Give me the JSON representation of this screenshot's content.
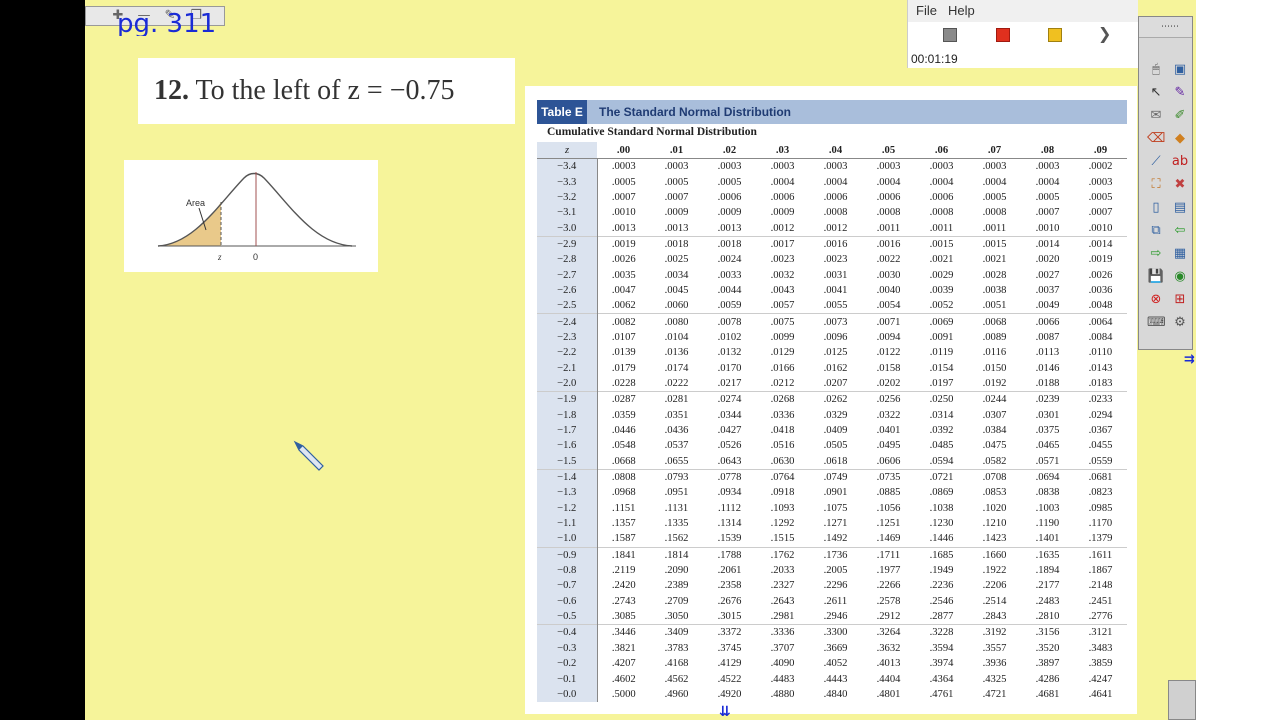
{
  "page_label": "pg. 311",
  "problem": {
    "number": "12.",
    "text": "To the left of z = −0.75"
  },
  "curve_figure": {
    "area_label": "Area",
    "z_label": "z",
    "zero_label": "0",
    "shade_color": "#e9c98a"
  },
  "table": {
    "tag": "Table E",
    "title": "The Standard Normal Distribution",
    "subtitle": "Cumulative Standard Normal Distribution",
    "z_header": "z",
    "columns": [
      ".00",
      ".01",
      ".02",
      ".03",
      ".04",
      ".05",
      ".06",
      ".07",
      ".08",
      ".09"
    ],
    "rows": [
      {
        "z": "−3.4",
        "v": [
          ".0003",
          ".0003",
          ".0003",
          ".0003",
          ".0003",
          ".0003",
          ".0003",
          ".0003",
          ".0003",
          ".0002"
        ]
      },
      {
        "z": "−3.3",
        "v": [
          ".0005",
          ".0005",
          ".0005",
          ".0004",
          ".0004",
          ".0004",
          ".0004",
          ".0004",
          ".0004",
          ".0003"
        ]
      },
      {
        "z": "−3.2",
        "v": [
          ".0007",
          ".0007",
          ".0006",
          ".0006",
          ".0006",
          ".0006",
          ".0006",
          ".0005",
          ".0005",
          ".0005"
        ]
      },
      {
        "z": "−3.1",
        "v": [
          ".0010",
          ".0009",
          ".0009",
          ".0009",
          ".0008",
          ".0008",
          ".0008",
          ".0008",
          ".0007",
          ".0007"
        ]
      },
      {
        "z": "−3.0",
        "v": [
          ".0013",
          ".0013",
          ".0013",
          ".0012",
          ".0012",
          ".0011",
          ".0011",
          ".0011",
          ".0010",
          ".0010"
        ]
      },
      {
        "z": "−2.9",
        "v": [
          ".0019",
          ".0018",
          ".0018",
          ".0017",
          ".0016",
          ".0016",
          ".0015",
          ".0015",
          ".0014",
          ".0014"
        ]
      },
      {
        "z": "−2.8",
        "v": [
          ".0026",
          ".0025",
          ".0024",
          ".0023",
          ".0023",
          ".0022",
          ".0021",
          ".0021",
          ".0020",
          ".0019"
        ]
      },
      {
        "z": "−2.7",
        "v": [
          ".0035",
          ".0034",
          ".0033",
          ".0032",
          ".0031",
          ".0030",
          ".0029",
          ".0028",
          ".0027",
          ".0026"
        ]
      },
      {
        "z": "−2.6",
        "v": [
          ".0047",
          ".0045",
          ".0044",
          ".0043",
          ".0041",
          ".0040",
          ".0039",
          ".0038",
          ".0037",
          ".0036"
        ]
      },
      {
        "z": "−2.5",
        "v": [
          ".0062",
          ".0060",
          ".0059",
          ".0057",
          ".0055",
          ".0054",
          ".0052",
          ".0051",
          ".0049",
          ".0048"
        ]
      },
      {
        "z": "−2.4",
        "v": [
          ".0082",
          ".0080",
          ".0078",
          ".0075",
          ".0073",
          ".0071",
          ".0069",
          ".0068",
          ".0066",
          ".0064"
        ]
      },
      {
        "z": "−2.3",
        "v": [
          ".0107",
          ".0104",
          ".0102",
          ".0099",
          ".0096",
          ".0094",
          ".0091",
          ".0089",
          ".0087",
          ".0084"
        ]
      },
      {
        "z": "−2.2",
        "v": [
          ".0139",
          ".0136",
          ".0132",
          ".0129",
          ".0125",
          ".0122",
          ".0119",
          ".0116",
          ".0113",
          ".0110"
        ]
      },
      {
        "z": "−2.1",
        "v": [
          ".0179",
          ".0174",
          ".0170",
          ".0166",
          ".0162",
          ".0158",
          ".0154",
          ".0150",
          ".0146",
          ".0143"
        ]
      },
      {
        "z": "−2.0",
        "v": [
          ".0228",
          ".0222",
          ".0217",
          ".0212",
          ".0207",
          ".0202",
          ".0197",
          ".0192",
          ".0188",
          ".0183"
        ]
      },
      {
        "z": "−1.9",
        "v": [
          ".0287",
          ".0281",
          ".0274",
          ".0268",
          ".0262",
          ".0256",
          ".0250",
          ".0244",
          ".0239",
          ".0233"
        ]
      },
      {
        "z": "−1.8",
        "v": [
          ".0359",
          ".0351",
          ".0344",
          ".0336",
          ".0329",
          ".0322",
          ".0314",
          ".0307",
          ".0301",
          ".0294"
        ]
      },
      {
        "z": "−1.7",
        "v": [
          ".0446",
          ".0436",
          ".0427",
          ".0418",
          ".0409",
          ".0401",
          ".0392",
          ".0384",
          ".0375",
          ".0367"
        ]
      },
      {
        "z": "−1.6",
        "v": [
          ".0548",
          ".0537",
          ".0526",
          ".0516",
          ".0505",
          ".0495",
          ".0485",
          ".0475",
          ".0465",
          ".0455"
        ]
      },
      {
        "z": "−1.5",
        "v": [
          ".0668",
          ".0655",
          ".0643",
          ".0630",
          ".0618",
          ".0606",
          ".0594",
          ".0582",
          ".0571",
          ".0559"
        ]
      },
      {
        "z": "−1.4",
        "v": [
          ".0808",
          ".0793",
          ".0778",
          ".0764",
          ".0749",
          ".0735",
          ".0721",
          ".0708",
          ".0694",
          ".0681"
        ]
      },
      {
        "z": "−1.3",
        "v": [
          ".0968",
          ".0951",
          ".0934",
          ".0918",
          ".0901",
          ".0885",
          ".0869",
          ".0853",
          ".0838",
          ".0823"
        ]
      },
      {
        "z": "−1.2",
        "v": [
          ".1151",
          ".1131",
          ".1112",
          ".1093",
          ".1075",
          ".1056",
          ".1038",
          ".1020",
          ".1003",
          ".0985"
        ]
      },
      {
        "z": "−1.1",
        "v": [
          ".1357",
          ".1335",
          ".1314",
          ".1292",
          ".1271",
          ".1251",
          ".1230",
          ".1210",
          ".1190",
          ".1170"
        ]
      },
      {
        "z": "−1.0",
        "v": [
          ".1587",
          ".1562",
          ".1539",
          ".1515",
          ".1492",
          ".1469",
          ".1446",
          ".1423",
          ".1401",
          ".1379"
        ]
      },
      {
        "z": "−0.9",
        "v": [
          ".1841",
          ".1814",
          ".1788",
          ".1762",
          ".1736",
          ".1711",
          ".1685",
          ".1660",
          ".1635",
          ".1611"
        ]
      },
      {
        "z": "−0.8",
        "v": [
          ".2119",
          ".2090",
          ".2061",
          ".2033",
          ".2005",
          ".1977",
          ".1949",
          ".1922",
          ".1894",
          ".1867"
        ]
      },
      {
        "z": "−0.7",
        "v": [
          ".2420",
          ".2389",
          ".2358",
          ".2327",
          ".2296",
          ".2266",
          ".2236",
          ".2206",
          ".2177",
          ".2148"
        ]
      },
      {
        "z": "−0.6",
        "v": [
          ".2743",
          ".2709",
          ".2676",
          ".2643",
          ".2611",
          ".2578",
          ".2546",
          ".2514",
          ".2483",
          ".2451"
        ]
      },
      {
        "z": "−0.5",
        "v": [
          ".3085",
          ".3050",
          ".3015",
          ".2981",
          ".2946",
          ".2912",
          ".2877",
          ".2843",
          ".2810",
          ".2776"
        ]
      },
      {
        "z": "−0.4",
        "v": [
          ".3446",
          ".3409",
          ".3372",
          ".3336",
          ".3300",
          ".3264",
          ".3228",
          ".3192",
          ".3156",
          ".3121"
        ]
      },
      {
        "z": "−0.3",
        "v": [
          ".3821",
          ".3783",
          ".3745",
          ".3707",
          ".3669",
          ".3632",
          ".3594",
          ".3557",
          ".3520",
          ".3483"
        ]
      },
      {
        "z": "−0.2",
        "v": [
          ".4207",
          ".4168",
          ".4129",
          ".4090",
          ".4052",
          ".4013",
          ".3974",
          ".3936",
          ".3897",
          ".3859"
        ]
      },
      {
        "z": "−0.1",
        "v": [
          ".4602",
          ".4562",
          ".4522",
          ".4483",
          ".4443",
          ".4404",
          ".4364",
          ".4325",
          ".4286",
          ".4247"
        ]
      },
      {
        "z": "−0.0",
        "v": [
          ".5000",
          ".4960",
          ".4920",
          ".4880",
          ".4840",
          ".4801",
          ".4761",
          ".4721",
          ".4681",
          ".4641"
        ]
      }
    ]
  },
  "recorder": {
    "menu": [
      "File",
      "Help"
    ],
    "buttons": [
      "stop-button",
      "record-button",
      "pause-button",
      "play-button"
    ],
    "elapsed": "00:01:19"
  },
  "mini_toolbar": [
    "add-icon",
    "minus-icon",
    "edit-icon",
    "copy-icon"
  ],
  "palette_tools": [
    "mouse-icon",
    "select-page-icon",
    "pointer-icon",
    "pen-icon",
    "note-icon",
    "highlighter-icon",
    "eraser-icon",
    "shapes-icon",
    "line-icon",
    "text-abc-icon",
    "fill-icon",
    "delete-icon",
    "new-page-icon",
    "page-icon",
    "screen-capture-icon",
    "back-icon",
    "forward-icon",
    "table-icon",
    "save-icon",
    "camera-icon",
    "close-red-icon",
    "insert-icon",
    "keyboard-icon",
    "settings-icon"
  ],
  "bottom_arrows": "⇊"
}
